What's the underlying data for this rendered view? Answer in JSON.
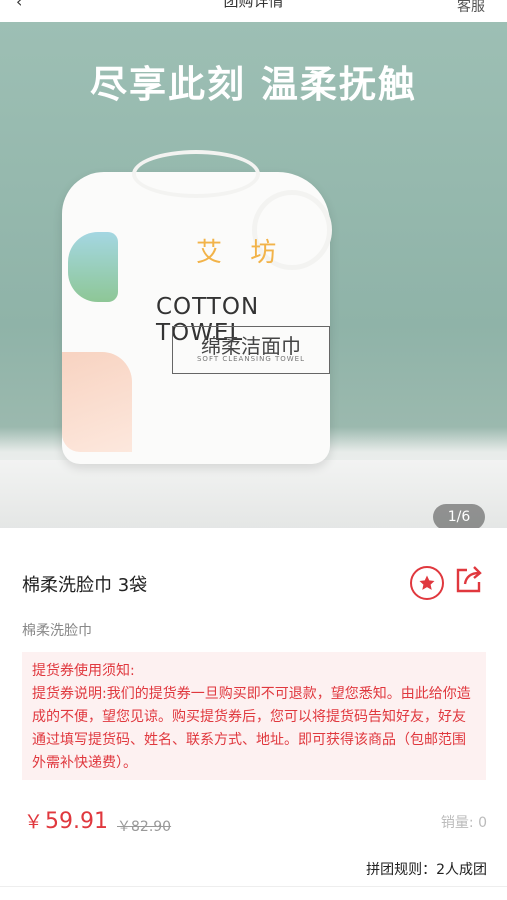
{
  "topbar": {
    "back_label": "‹",
    "title_fragment": "团购详情",
    "service_label": "客服"
  },
  "hero": {
    "headline": "尽享此刻 温柔抚触",
    "pager": "1/6",
    "product_art": {
      "logo": "艾 坊",
      "brand": "COTTON TOWEL",
      "cn_label": "绵柔洁面巾",
      "en_label": "SOFT CLEANSING TOWEL"
    }
  },
  "product": {
    "title": "棉柔洗脸巾 3袋",
    "subtitle": "棉柔洗脸巾"
  },
  "notice": {
    "heading": "提货券使用须知:",
    "body": "提货券说明:我们的提货券一旦购买即不可退款，望您悉知。由此给你造成的不便，望您见谅。购买提货券后，您可以将提货码告知好友，好友通过填写提货码、姓名、联系方式、地址。即可获得该商品（包邮范围外需补快递费）。"
  },
  "pricing": {
    "currency": "￥",
    "price": "59.91",
    "original_price": "￥82.90",
    "sales": "销量: 0"
  },
  "group_rule": "拼团规则：2人成团",
  "colors": {
    "accent": "#e0383e",
    "notice_bg": "#fdf1f1",
    "hero_bg": "#9dbfb4"
  },
  "icons": {
    "favorite": "star-icon",
    "share": "share-icon"
  }
}
